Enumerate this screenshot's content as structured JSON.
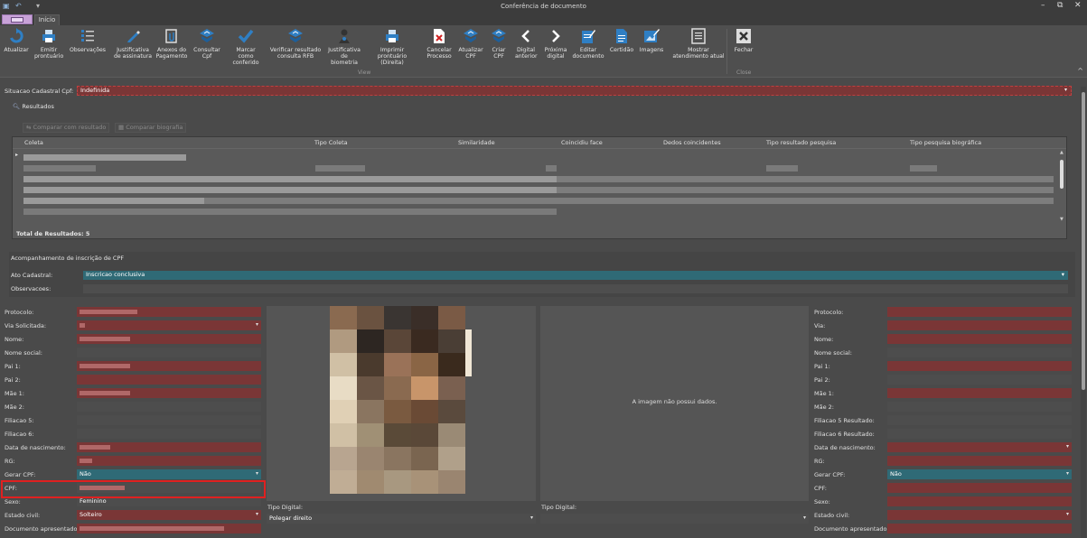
{
  "window": {
    "title": "Conferência de documento",
    "tab_inicio": "Início",
    "controls": {
      "minimize": "–",
      "restore": "⧉",
      "close": "✕"
    }
  },
  "ribbon": {
    "buttons": [
      {
        "label": "Atualizar",
        "icon": "refresh-icon"
      },
      {
        "label": "Emitir prontuário",
        "icon": "printer-icon"
      },
      {
        "label": "Observações",
        "icon": "list-icon"
      },
      {
        "label": "Justificativa de assinatura",
        "icon": "pen-icon"
      },
      {
        "label": "Anexos do Pagamento",
        "icon": "attachment-icon"
      },
      {
        "label": "Consultar Cpf",
        "icon": "seal-icon"
      },
      {
        "label": "Marcar como conferido",
        "icon": "check-icon"
      },
      {
        "label": "Verificar resultado consulta RFB",
        "icon": "seal-icon"
      },
      {
        "label": "Justificativa de biometria",
        "icon": "person-icon"
      },
      {
        "label": "Imprimir prontuário (Direita)",
        "icon": "printer-icon"
      },
      {
        "label": "Cancelar Processo",
        "icon": "cancel-doc-icon"
      },
      {
        "label": "Atualizar CPF",
        "icon": "seal-icon"
      },
      {
        "label": "Criar CPF",
        "icon": "seal-icon"
      },
      {
        "label": "Digital anterior",
        "icon": "chevron-left-icon"
      },
      {
        "label": "Próxima digital",
        "icon": "chevron-right-icon"
      },
      {
        "label": "Editar documento",
        "icon": "edit-doc-icon"
      },
      {
        "label": "Certidão",
        "icon": "document-icon"
      },
      {
        "label": "Imagens",
        "icon": "image-edit-icon"
      },
      {
        "label": "Mostrar atendimento atual",
        "icon": "form-icon"
      },
      {
        "label": "Fechar",
        "icon": "close-box-icon"
      }
    ],
    "group_view": "View",
    "group_close": "Close"
  },
  "situacao": {
    "label": "Situacao Cadastral Cpf:",
    "value": "Indefinida"
  },
  "resultados": {
    "title": "Resultados",
    "btn_comparar": "Comparar com resultado",
    "btn_biografia": "Comparar biografia",
    "columns": [
      "Coleta",
      "Tipo Coleta",
      "Similaridade",
      "Coincidiu face",
      "Dedos coincidentes",
      "Tipo resultado pesquisa",
      "Tipo pesquisa biográfica"
    ],
    "total": "Total de Resultados: 5"
  },
  "acompanhamento": {
    "title": "Acompanhamento de inscrição de CPF",
    "ato_label": "Ato Cadastral:",
    "ato_value": "Inscricao conclusiva",
    "obs_label": "Observacoes:"
  },
  "left_form": {
    "labels": [
      "Protocolo:",
      "Via Solicitada:",
      "Nome:",
      "Nome social:",
      "Pai 1:",
      "Pai 2:",
      "Mãe 1:",
      "Mãe 2:",
      "Filiacao 5:",
      "Filiacao 6:",
      "Data de nascimento:",
      "RG:",
      "Gerar CPF:",
      "CPF:",
      "Sexo:",
      "Estado civil:",
      "Documento apresentado:"
    ],
    "gerar_cpf": "Não",
    "sexo": "Feminino",
    "estado_civil": "Solteiro"
  },
  "middle": {
    "tipo_digital_label": "Tipo Digital:",
    "tipo_digital_value": "Polegar direito"
  },
  "right_panel": {
    "no_image": "A imagem não possui dados.",
    "tipo_digital_label": "Tipo Digital:"
  },
  "right_form": {
    "labels": [
      "Protocolo:",
      "Via:",
      "Nome:",
      "Nome social:",
      "Pai 1:",
      "Pai 2:",
      "Mãe 1:",
      "Mãe 2:",
      "Filiacao 5 Resultado:",
      "Filiacao 6 Resultado:",
      "Data de nascimento:",
      "RG:",
      "Gerar CPF:",
      "CPF:",
      "Sexo:",
      "Estado civil:",
      "Documento apresentado:"
    ],
    "gerar_cpf": "Não"
  }
}
